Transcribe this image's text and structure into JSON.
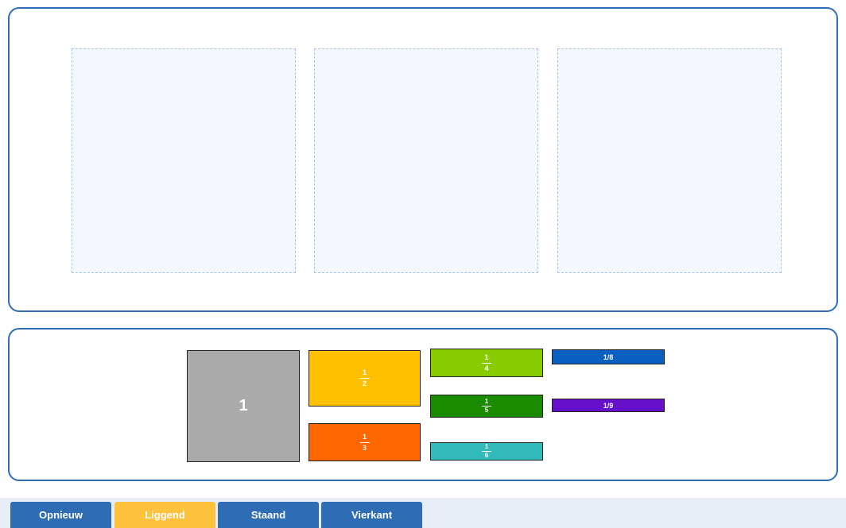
{
  "tiles": {
    "whole": {
      "label": "1"
    },
    "half": {
      "numerator": "1",
      "denominator": "2"
    },
    "third": {
      "numerator": "1",
      "denominator": "3"
    },
    "quarter": {
      "numerator": "1",
      "denominator": "4"
    },
    "fifth": {
      "numerator": "1",
      "denominator": "5"
    },
    "sixth": {
      "numerator": "1",
      "denominator": "6"
    },
    "eighth": {
      "label": "1/8"
    },
    "ninth": {
      "label": "1/9"
    }
  },
  "colors": {
    "accent": "#2f6db5",
    "button_default": "#2e6db4",
    "button_active": "#ffc23d",
    "whole": "#aaaaaa",
    "half": "#ffc000",
    "third": "#ff6600",
    "quarter": "#88cc00",
    "fifth": "#1a8a00",
    "sixth": "#33bbbb",
    "eighth": "#0a60c0",
    "ninth": "#6610cc"
  },
  "toolbar": {
    "active": "Liggend",
    "buttons": [
      {
        "label": "Opnieuw"
      },
      {
        "label": "Liggend"
      },
      {
        "label": "Staand"
      },
      {
        "label": "Vierkant"
      }
    ]
  }
}
